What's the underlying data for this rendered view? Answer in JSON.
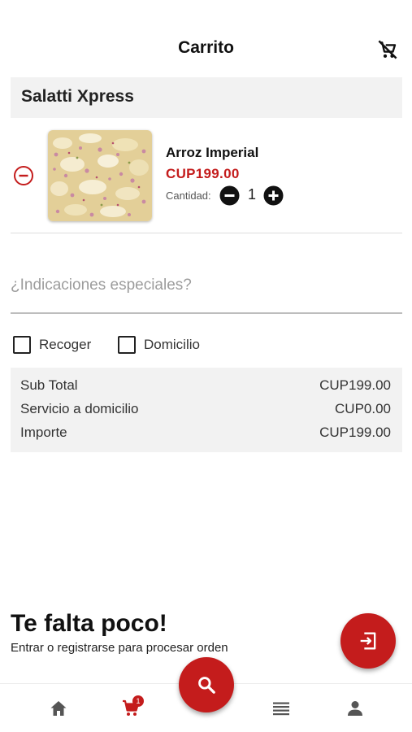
{
  "app_bar": {
    "title": "Carrito",
    "clear_cart_icon": "remove-shopping-cart-icon"
  },
  "store": {
    "name": "Salatti Xpress"
  },
  "cart_items": [
    {
      "name": "Arroz Imperial",
      "price": "CUP199.00",
      "quantity_label": "Cantidad:",
      "quantity": "1",
      "image": "arroz-imperial-photo"
    }
  ],
  "special_instructions": {
    "placeholder": "¿Indicaciones especiales?",
    "value": ""
  },
  "delivery_options": [
    {
      "label": "Recoger",
      "checked": false
    },
    {
      "label": "Domicilio",
      "checked": false
    }
  ],
  "summary": {
    "rows": [
      {
        "label": "Sub Total",
        "value": "CUP199.00"
      },
      {
        "label": "Servicio a domicilio",
        "value": "CUP0.00"
      },
      {
        "label": "Importe",
        "value": "CUP199.00"
      }
    ]
  },
  "login_prompt": {
    "title": "Te falta poco!",
    "subtitle": "Entrar o registrarse para procesar orden"
  },
  "bottom_nav": {
    "items": [
      {
        "icon": "home-icon"
      },
      {
        "icon": "shopping-cart-icon",
        "badge": "1"
      },
      {
        "icon": "search-icon"
      },
      {
        "icon": "list-icon"
      },
      {
        "icon": "person-icon"
      }
    ]
  },
  "colors": {
    "accent": "#c41c1c",
    "panel": "#f2f2f2",
    "text": "#1a1a1a",
    "muted": "#9c9c9c"
  }
}
